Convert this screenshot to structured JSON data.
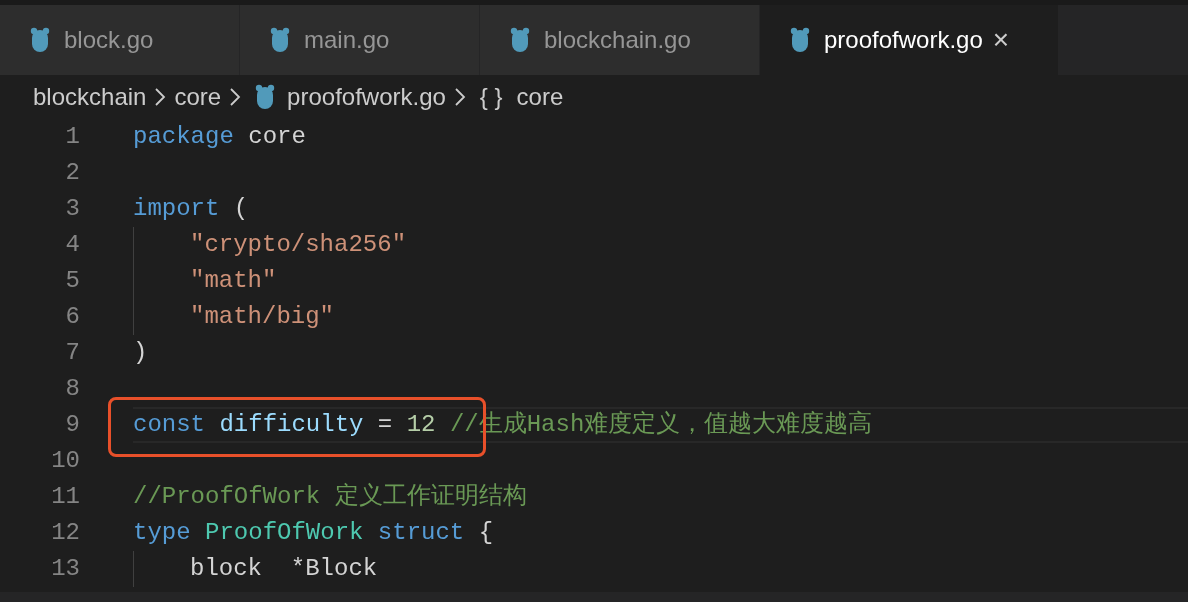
{
  "tabs": [
    {
      "label": "block.go",
      "selected": false
    },
    {
      "label": "main.go",
      "selected": false
    },
    {
      "label": "blockchain.go",
      "selected": false
    },
    {
      "label": "proofofwork.go",
      "selected": true,
      "close": "×"
    }
  ],
  "breadcrumb": [
    {
      "kind": "folder",
      "label": "blockchain"
    },
    {
      "kind": "folder",
      "label": "core"
    },
    {
      "kind": "file",
      "label": "proofofwork.go"
    },
    {
      "kind": "symbol",
      "glyph": "{ }",
      "label": "core"
    }
  ],
  "lines": [
    {
      "number": "1",
      "indented": false,
      "current": false,
      "marked": false,
      "tokens": [
        {
          "kind": "keyword",
          "text": "package"
        },
        {
          "kind": "plain",
          "text": " core"
        }
      ]
    },
    {
      "number": "2",
      "indented": false,
      "current": false,
      "marked": false
    },
    {
      "number": "3",
      "indented": false,
      "current": false,
      "marked": false,
      "tokens": [
        {
          "kind": "keyword",
          "text": "import"
        },
        {
          "kind": "plain",
          "text": " ("
        }
      ]
    },
    {
      "number": "4",
      "indented": true,
      "current": false,
      "marked": false,
      "tokens": [
        {
          "kind": "string",
          "text": "\"crypto/sha256\""
        }
      ]
    },
    {
      "number": "5",
      "indented": true,
      "current": false,
      "marked": false,
      "tokens": [
        {
          "kind": "string",
          "text": "\"math\""
        }
      ]
    },
    {
      "number": "6",
      "indented": true,
      "current": false,
      "marked": false,
      "tokens": [
        {
          "kind": "string",
          "text": "\"math/big\""
        }
      ]
    },
    {
      "number": "7",
      "indented": false,
      "current": false,
      "marked": false,
      "tokens": [
        {
          "kind": "plain",
          "text": ")"
        }
      ]
    },
    {
      "number": "8",
      "indented": false,
      "current": false,
      "marked": false
    },
    {
      "number": "9",
      "indented": false,
      "current": true,
      "marked": true,
      "tokens": [
        {
          "kind": "keyword",
          "text": "const "
        },
        {
          "kind": "constant",
          "text": "difficulty"
        },
        {
          "kind": "plain",
          "text": " = "
        },
        {
          "kind": "number",
          "text": "12"
        },
        {
          "kind": "comment",
          "text": " //生成Hash难度定义，值越大难度越高"
        }
      ]
    },
    {
      "number": "10",
      "indented": false,
      "current": false,
      "marked": false
    },
    {
      "number": "11",
      "indented": false,
      "current": false,
      "marked": false,
      "tokens": [
        {
          "kind": "comment",
          "text": "//ProofOfWork 定义工作证明结构"
        }
      ]
    },
    {
      "number": "12",
      "indented": false,
      "current": false,
      "marked": false,
      "tokens": [
        {
          "kind": "keyword",
          "text": "type "
        },
        {
          "kind": "type",
          "text": "ProofOfWork "
        },
        {
          "kind": "keyword",
          "text": "struct"
        },
        {
          "kind": "plain",
          "text": " {"
        }
      ]
    },
    {
      "number": "13",
      "indented": true,
      "current": false,
      "marked": false,
      "tokens": [
        {
          "kind": "plain",
          "text": "block  *Block"
        }
      ]
    }
  ]
}
